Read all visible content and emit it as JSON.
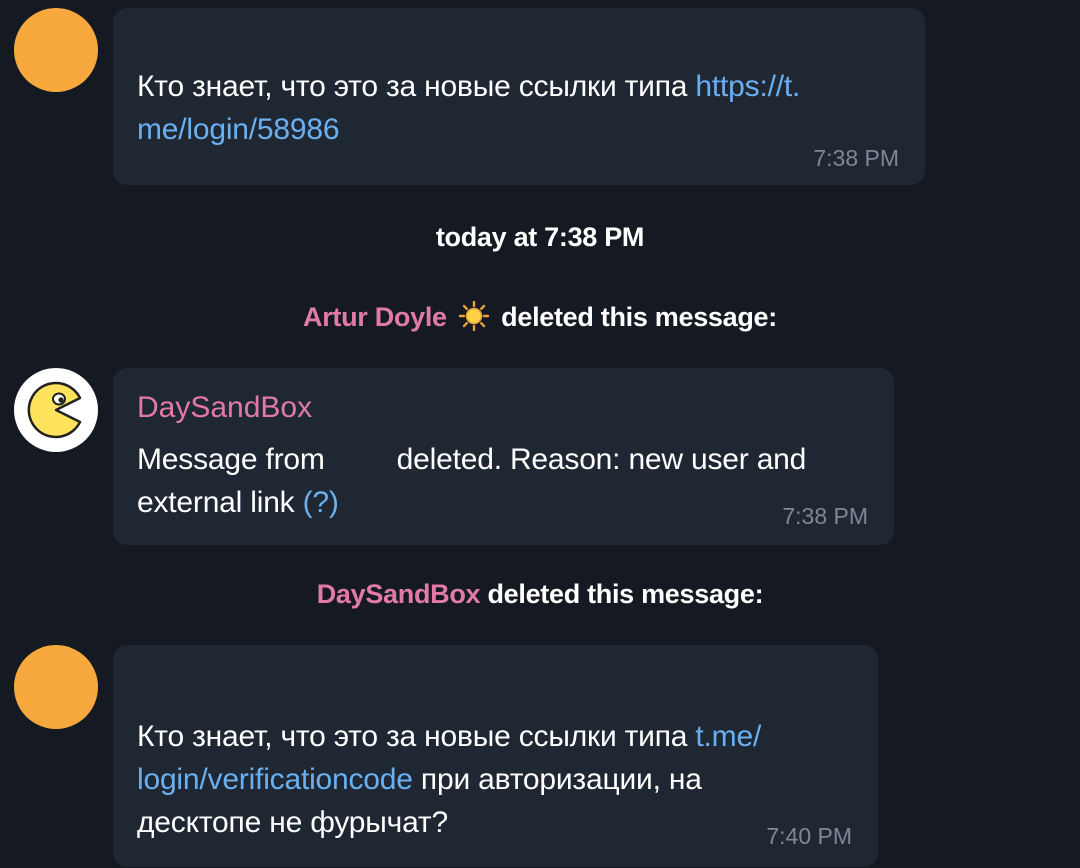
{
  "messages": {
    "first": {
      "text_prefix": "Кто знает, что это за новые ссылки типа ",
      "link_part1": "https://t.",
      "link_part2": "me/login/58986",
      "time": "7:38 PM"
    },
    "date_separator": "today at 7:38 PM",
    "deleted_notice_1": {
      "actor": "Artur Doyle",
      "icon": "sun-icon",
      "suffix": " deleted this message:"
    },
    "bot_message": {
      "sender": "DaySandBox",
      "line1_a": "Message from",
      "line1_b": "deleted. Reason: new user and",
      "line2_a": "external link ",
      "line2_link": "(?)",
      "time": "7:38 PM"
    },
    "deleted_notice_2": {
      "actor": "DaySandBox",
      "suffix": " deleted this message:"
    },
    "last": {
      "line1_a": "Кто знает, что это за новые ссылки типа ",
      "line1_link": "t.me/",
      "line2_link": "login/verificationcode",
      "line2_b": " при авторизации, на",
      "line3": "десктопе не фурычат?",
      "time": "7:40 PM"
    }
  },
  "colors": {
    "background": "#151a22",
    "bubble": "#1f2733",
    "link": "#6ab0f1",
    "name_accent": "#e27aa6",
    "avatar_orange": "#f7a93e",
    "timestamp": "#7d8895"
  }
}
